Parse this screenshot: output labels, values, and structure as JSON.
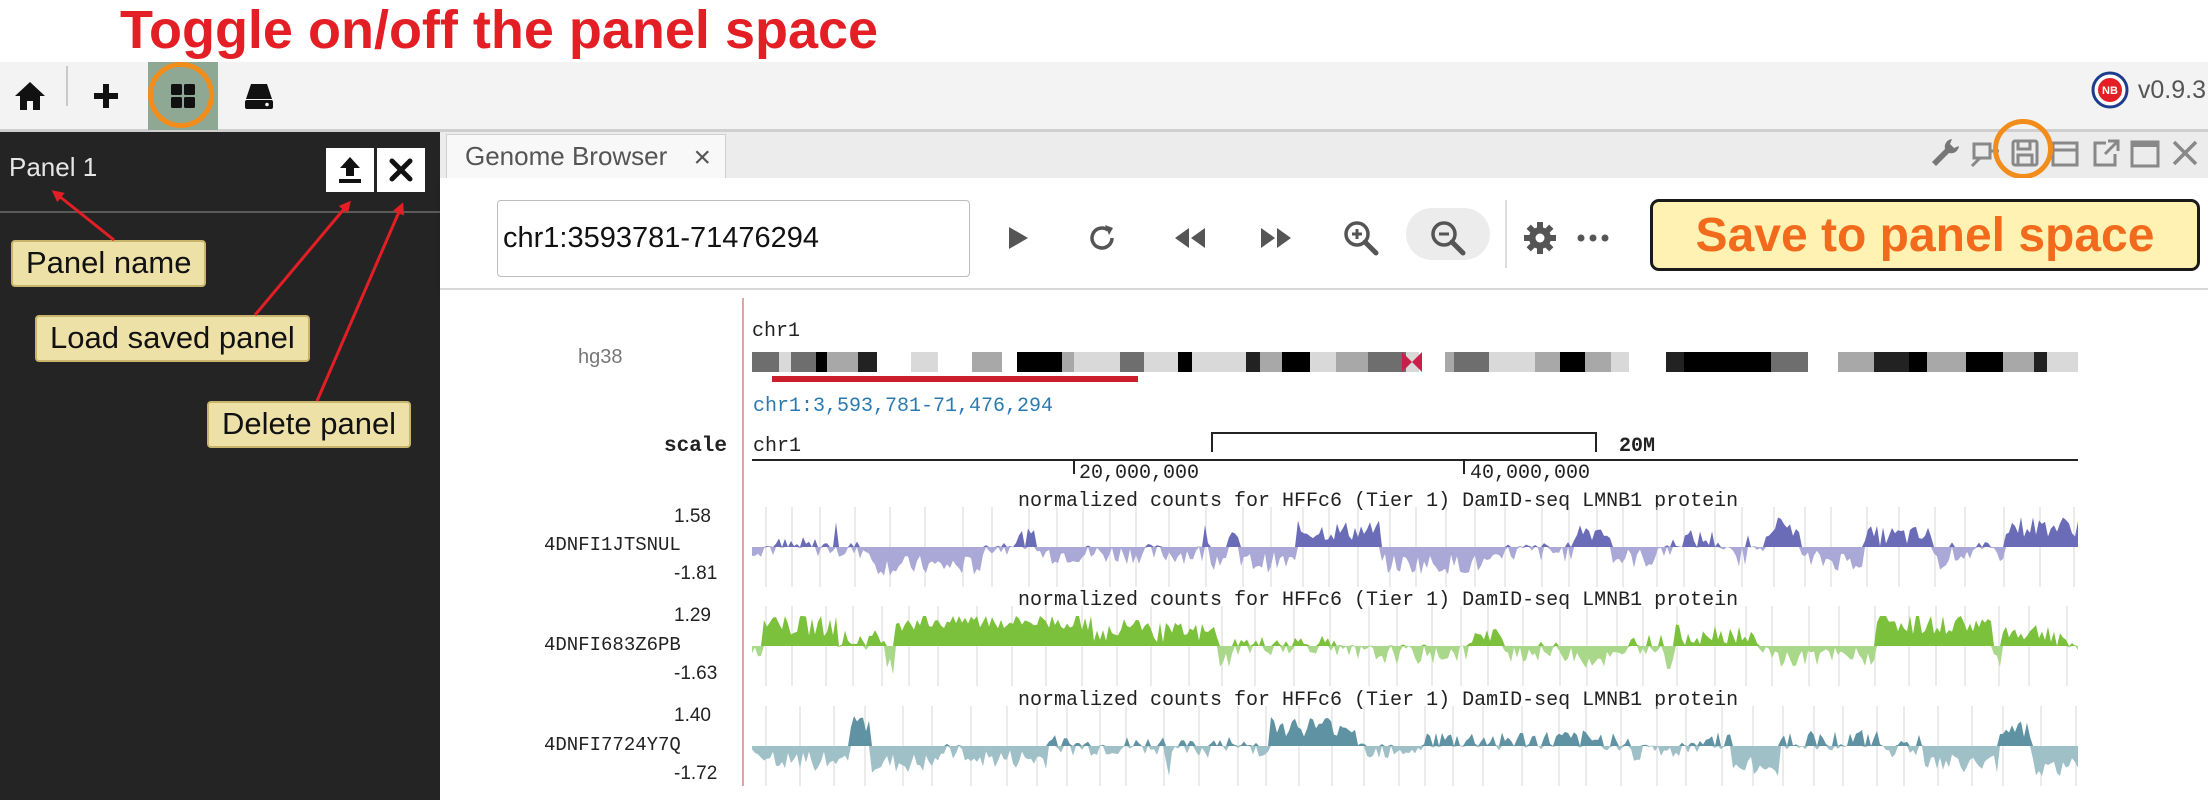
{
  "annotations": {
    "toggle_title": "Toggle on/off the panel space",
    "panel_name": "Panel name",
    "load_saved": "Load saved panel",
    "delete_panel": "Delete panel",
    "save_to_panel": "Save to panel space"
  },
  "toolbar": {
    "version": "v0.9.3",
    "logo_text": "NB",
    "icons": [
      "home-icon",
      "plus-icon",
      "grid-icon",
      "drive-icon"
    ]
  },
  "sidebar": {
    "panel_name": "Panel 1",
    "buttons": [
      "upload-icon",
      "close-icon"
    ]
  },
  "browser": {
    "tab_label": "Genome Browser",
    "tab_close": "×",
    "locus": "chr1:3593781-71476294",
    "nav_icons": [
      "play-icon",
      "refresh-icon",
      "rewind-icon",
      "fast-forward-icon",
      "zoom-in-icon",
      "zoom-out-icon",
      "gear-icon",
      "more-icon"
    ],
    "window_icons": [
      "wrench-icon",
      "pin-icon",
      "save-icon",
      "minimize-icon",
      "popout-icon",
      "maximize-icon",
      "close-icon"
    ]
  },
  "genome": {
    "assembly": "hg38",
    "chrom": "chr1",
    "coord_label": "chr1:3,593,781-71,476,294",
    "scale_label": "scale",
    "scale_chrom": "chr1",
    "scale_bar_label": "20M",
    "ticks": [
      "20,000,000",
      "40,000,000"
    ],
    "tracks": [
      {
        "name": "4DNFI1JTSNUL",
        "max": "1.58",
        "min": "-1.81",
        "title": "normalized counts for HFFc6 (Tier 1) DamID-seq LMNB1 protein",
        "color_top": "#6a6cb8",
        "color_bottom": "#a9a8d6"
      },
      {
        "name": "4DNFI683Z6PB",
        "max": "1.29",
        "min": "-1.63",
        "title": "normalized counts for HFFc6 (Tier 1) DamID-seq LMNB1 protein",
        "color_top": "#7cc13c",
        "color_bottom": "#aad88a"
      },
      {
        "name": "4DNFI7724Y7Q",
        "max": "1.40",
        "min": "-1.72",
        "title": "normalized counts for HFFc6 (Tier 1) DamID-seq LMNB1 protein",
        "color_top": "#5f93a3",
        "color_bottom": "#a0c0c7"
      }
    ]
  },
  "colors": {
    "annotation_red": "#e31e24",
    "annotation_orange": "#f28c1a",
    "tag_fill": "#ede1a8",
    "sidebar_bg": "#242424"
  }
}
